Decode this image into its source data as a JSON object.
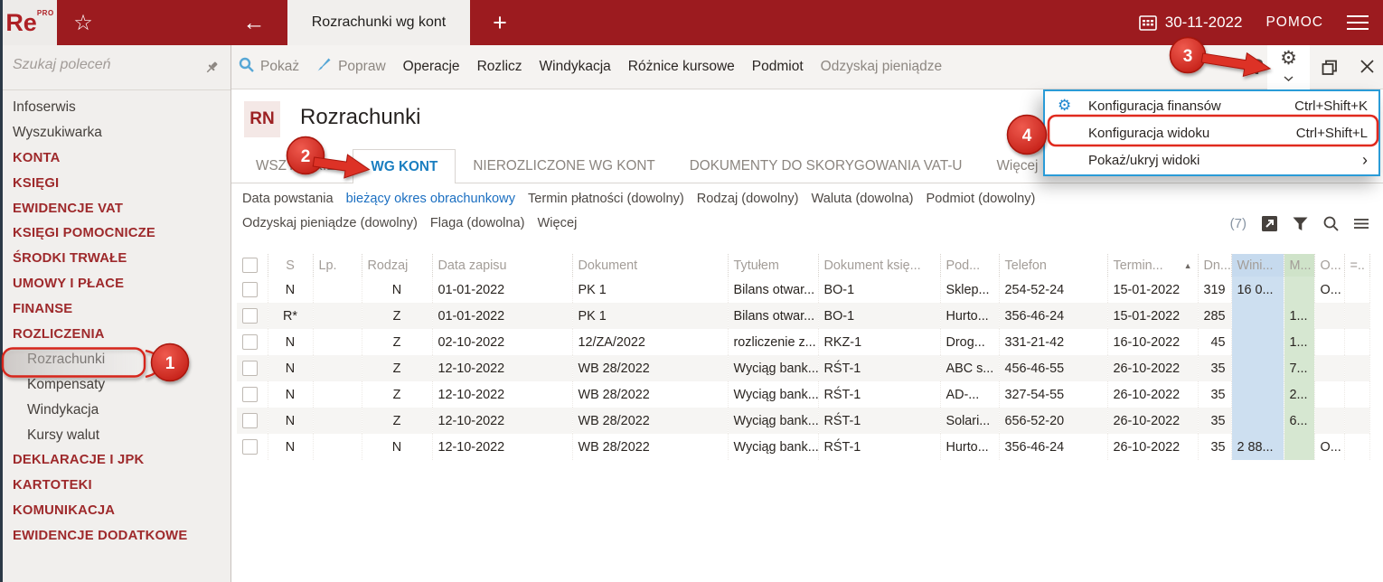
{
  "topbar": {
    "logo": "Re",
    "logo_sup": "PRO",
    "tab_title": "Rozrachunki wg kont",
    "date": "30-11-2022",
    "help_label": "POMOC"
  },
  "icons": {
    "star": "☆",
    "back": "←",
    "plus": "+",
    "gear": "⚙",
    "help_mark": "?",
    "submenu_arrow": "›",
    "sort_asc": "▲"
  },
  "colors": {
    "brand_red": "#9c1b1f",
    "annotation_red": "#dd3327",
    "link_blue": "#1b6fc1",
    "active_tab_blue": "#1a7ec0",
    "menu_border_blue": "#2a9bd7",
    "debit_column_bg": "#cddff0",
    "credit_column_bg": "#d6e7d1"
  },
  "sidebar": {
    "search_placeholder": "Szukaj poleceń",
    "items": [
      {
        "label": "Infoserwis",
        "type": "normal"
      },
      {
        "label": "Wyszukiwarka",
        "type": "normal"
      },
      {
        "label": "KONTA",
        "type": "section"
      },
      {
        "label": "KSIĘGI",
        "type": "section"
      },
      {
        "label": "EWIDENCJE VAT",
        "type": "section"
      },
      {
        "label": "KSIĘGI POMOCNICZE",
        "type": "section"
      },
      {
        "label": "ŚRODKI TRWAŁE",
        "type": "section"
      },
      {
        "label": "UMOWY I PŁACE",
        "type": "section"
      },
      {
        "label": "FINANSE",
        "type": "section"
      },
      {
        "label": "ROZLICZENIA",
        "type": "section"
      },
      {
        "label": "Rozrachunki",
        "type": "sub",
        "selected": true
      },
      {
        "label": "Kompensaty",
        "type": "sub"
      },
      {
        "label": "Windykacja",
        "type": "sub"
      },
      {
        "label": "Kursy walut",
        "type": "sub"
      },
      {
        "label": "DEKLARACJE I JPK",
        "type": "section"
      },
      {
        "label": "KARTOTEKI",
        "type": "section"
      },
      {
        "label": "KOMUNIKACJA",
        "type": "section"
      },
      {
        "label": "EWIDENCJE DODATKOWE",
        "type": "section"
      }
    ]
  },
  "commands": {
    "items": [
      {
        "label": "Pokaż",
        "icon": "search",
        "muted": true
      },
      {
        "label": "Popraw",
        "icon": "brush",
        "muted": true
      },
      {
        "label": "Operacje"
      },
      {
        "label": "Rozlicz"
      },
      {
        "label": "Windykacja"
      },
      {
        "label": "Różnice kursowe"
      },
      {
        "label": "Podmiot"
      },
      {
        "label": "Odzyskaj pieniądze",
        "muted": true
      }
    ]
  },
  "page": {
    "badge": "RN",
    "title": "Rozrachunki"
  },
  "tabs": {
    "items": [
      "WSZYSTKIE",
      "WG KONT",
      "NIEROZLICZONE WG KONT",
      "DOKUMENTY DO SKORYGOWANIA VAT-U",
      "Więcej"
    ],
    "active_index": 1
  },
  "filters": {
    "row1": [
      {
        "text": "Data powstania"
      },
      {
        "text": "bieżący okres obrachunkowy",
        "link": true
      },
      {
        "text": "Termin płatności (dowolny)"
      },
      {
        "text": "Rodzaj (dowolny)"
      },
      {
        "text": "Waluta (dowolna)"
      },
      {
        "text": "Podmiot (dowolny)"
      }
    ],
    "row2": [
      {
        "text": "Odzyskaj pieniądze (dowolny)"
      },
      {
        "text": "Flaga (dowolna)"
      },
      {
        "text": "Więcej"
      }
    ],
    "count": "(7)"
  },
  "table": {
    "columns": [
      {
        "key": "select",
        "label": ""
      },
      {
        "key": "s",
        "label": "S"
      },
      {
        "key": "lp",
        "label": "Lp."
      },
      {
        "key": "rodzaj",
        "label": "Rodzaj"
      },
      {
        "key": "data",
        "label": "Data zapisu"
      },
      {
        "key": "dokument",
        "label": "Dokument"
      },
      {
        "key": "tytulem",
        "label": "Tytułem"
      },
      {
        "key": "dok_ksieg",
        "label": "Dokument księ..."
      },
      {
        "key": "pod",
        "label": "Pod..."
      },
      {
        "key": "telefon",
        "label": "Telefon"
      },
      {
        "key": "termin",
        "label": "Termin...",
        "sorted": "asc"
      },
      {
        "key": "dn",
        "label": "Dn..."
      },
      {
        "key": "winien",
        "label": "Wini..."
      },
      {
        "key": "ma",
        "label": "M..."
      },
      {
        "key": "o",
        "label": "O..."
      },
      {
        "key": "extra",
        "label": "=.."
      }
    ],
    "rows": [
      {
        "s": "N",
        "lp": "",
        "rodzaj": "N",
        "data": "01-01-2022",
        "dokument": "PK 1",
        "tytulem": "Bilans otwar...",
        "dok_ksieg": "BO-1",
        "pod": "Sklep...",
        "telefon": "254-52-24",
        "termin": "15-01-2022",
        "dn": "319",
        "winien": "16 0...",
        "ma": "",
        "o": "O...",
        "extra": ""
      },
      {
        "s": "R*",
        "lp": "",
        "rodzaj": "Z",
        "data": "01-01-2022",
        "dokument": "PK 1",
        "tytulem": "Bilans otwar...",
        "dok_ksieg": "BO-1",
        "pod": "Hurto...",
        "telefon": "356-46-24",
        "termin": "15-01-2022",
        "dn": "285",
        "winien": "",
        "ma": "1...",
        "o": "",
        "extra": ""
      },
      {
        "s": "N",
        "lp": "",
        "rodzaj": "Z",
        "data": "02-10-2022",
        "dokument": "12/ZA/2022",
        "tytulem": "rozliczenie z...",
        "dok_ksieg": "RKZ-1",
        "pod": "Drog...",
        "telefon": "331-21-42",
        "termin": "16-10-2022",
        "dn": "45",
        "winien": "",
        "ma": "1...",
        "o": "",
        "extra": ""
      },
      {
        "s": "N",
        "lp": "",
        "rodzaj": "Z",
        "data": "12-10-2022",
        "dokument": "WB 28/2022",
        "tytulem": "Wyciąg bank...",
        "dok_ksieg": "RŚT-1",
        "pod": "ABC s...",
        "telefon": "456-46-55",
        "termin": "26-10-2022",
        "dn": "35",
        "winien": "",
        "ma": "7...",
        "o": "",
        "extra": ""
      },
      {
        "s": "N",
        "lp": "",
        "rodzaj": "Z",
        "data": "12-10-2022",
        "dokument": "WB 28/2022",
        "tytulem": "Wyciąg bank...",
        "dok_ksieg": "RŚT-1",
        "pod": "AD-...",
        "telefon": "327-54-55",
        "termin": "26-10-2022",
        "dn": "35",
        "winien": "",
        "ma": "2...",
        "o": "",
        "extra": ""
      },
      {
        "s": "N",
        "lp": "",
        "rodzaj": "Z",
        "data": "12-10-2022",
        "dokument": "WB 28/2022",
        "tytulem": "Wyciąg bank...",
        "dok_ksieg": "RŚT-1",
        "pod": "Solari...",
        "telefon": "656-52-20",
        "termin": "26-10-2022",
        "dn": "35",
        "winien": "",
        "ma": "6...",
        "o": "",
        "extra": ""
      },
      {
        "s": "N",
        "lp": "",
        "rodzaj": "N",
        "data": "12-10-2022",
        "dokument": "WB 28/2022",
        "tytulem": "Wyciąg bank...",
        "dok_ksieg": "RŚT-1",
        "pod": "Hurto...",
        "telefon": "356-46-24",
        "termin": "26-10-2022",
        "dn": "35",
        "winien": "2 88...",
        "ma": "",
        "o": "O...",
        "extra": ""
      }
    ]
  },
  "context_menu": {
    "items": [
      {
        "label": "Konfiguracja finansów",
        "shortcut": "Ctrl+Shift+K",
        "icon": "gear"
      },
      {
        "label": "Konfiguracja widoku",
        "shortcut": "Ctrl+Shift+L",
        "highlighted": true
      },
      {
        "label": "Pokaż/ukryj widoki",
        "submenu": true
      }
    ]
  },
  "annotations": {
    "steps": [
      "1",
      "2",
      "3",
      "4"
    ]
  }
}
